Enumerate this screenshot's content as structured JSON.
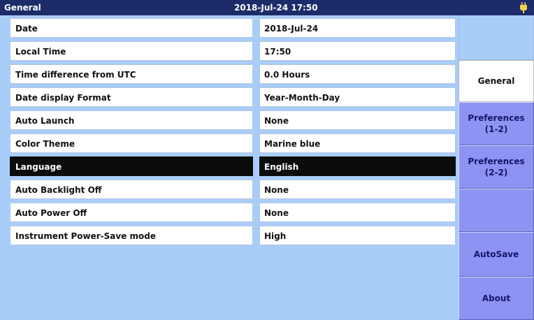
{
  "titlebar": {
    "title": "General",
    "datetime": "2018-Jul-24 17:50",
    "status_icon": "power-plug-icon"
  },
  "settings": [
    {
      "name": "Date",
      "value": "2018-Jul-24",
      "selected": false
    },
    {
      "name": "Local Time",
      "value": "17:50",
      "selected": false
    },
    {
      "name": "Time difference from UTC",
      "value": "0.0 Hours",
      "selected": false
    },
    {
      "name": "Date display Format",
      "value": "Year-Month-Day",
      "selected": false
    },
    {
      "name": "Auto Launch",
      "value": "None",
      "selected": false
    },
    {
      "name": "Color Theme",
      "value": "Marine blue",
      "selected": false
    },
    {
      "name": "Language",
      "value": "English",
      "selected": true
    },
    {
      "name": "Auto Backlight Off",
      "value": "None",
      "selected": false
    },
    {
      "name": "Auto Power Off",
      "value": "None",
      "selected": false
    },
    {
      "name": "Instrument Power-Save mode",
      "value": "High",
      "selected": false
    }
  ],
  "sidepanel": {
    "general": "General",
    "prefs_1": "Preferences\n(1-2)",
    "prefs_2": "Preferences\n(2-2)",
    "autosave": "AutoSave",
    "about": "About"
  },
  "colors": {
    "background": "#a9cdf9",
    "titlebar": "#1c2c69",
    "side_button": "#8d93f2",
    "selected_row": "#0c0c0c"
  }
}
